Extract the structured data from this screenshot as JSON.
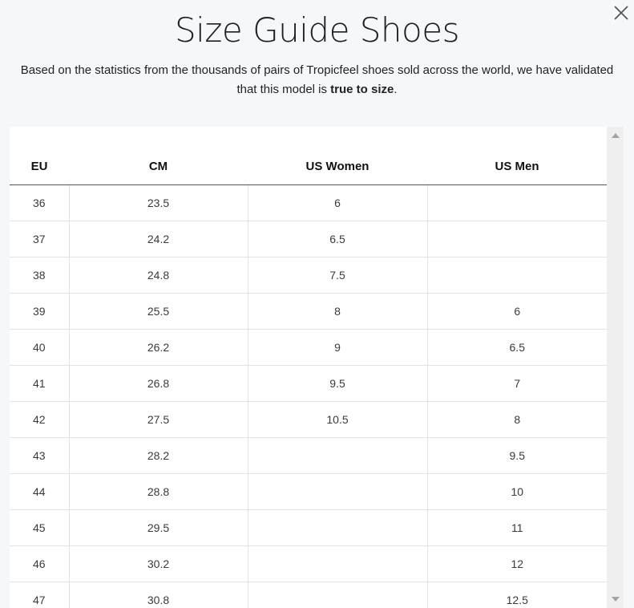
{
  "modal": {
    "title": "Size Guide Shoes",
    "intro_prefix": "Based on the statistics from the thousands of pairs of Tropicfeel shoes sold across the world, we have validated that this model is ",
    "intro_bold": "true to size",
    "intro_suffix": "."
  },
  "close_icon": "close-icon",
  "table": {
    "headers": [
      "EU",
      "CM",
      "US Women",
      "US Men"
    ],
    "rows": [
      [
        "36",
        "23.5",
        "6",
        ""
      ],
      [
        "37",
        "24.2",
        "6.5",
        ""
      ],
      [
        "38",
        "24.8",
        "7.5",
        ""
      ],
      [
        "39",
        "25.5",
        "8",
        "6"
      ],
      [
        "40",
        "26.2",
        "9",
        "6.5"
      ],
      [
        "41",
        "26.8",
        "9.5",
        "7"
      ],
      [
        "42",
        "27.5",
        "10.5",
        "8"
      ],
      [
        "43",
        "28.2",
        "",
        "9.5"
      ],
      [
        "44",
        "28.8",
        "",
        "10"
      ],
      [
        "45",
        "29.5",
        "",
        "11"
      ],
      [
        "46",
        "30.2",
        "",
        "12"
      ],
      [
        "47",
        "30.8",
        "",
        "12.5"
      ]
    ]
  },
  "colors": {
    "background": "#f6f7f9",
    "table_background": "#ffffff",
    "header_rule": "#555555",
    "cell_border": "#e3e3e3"
  }
}
